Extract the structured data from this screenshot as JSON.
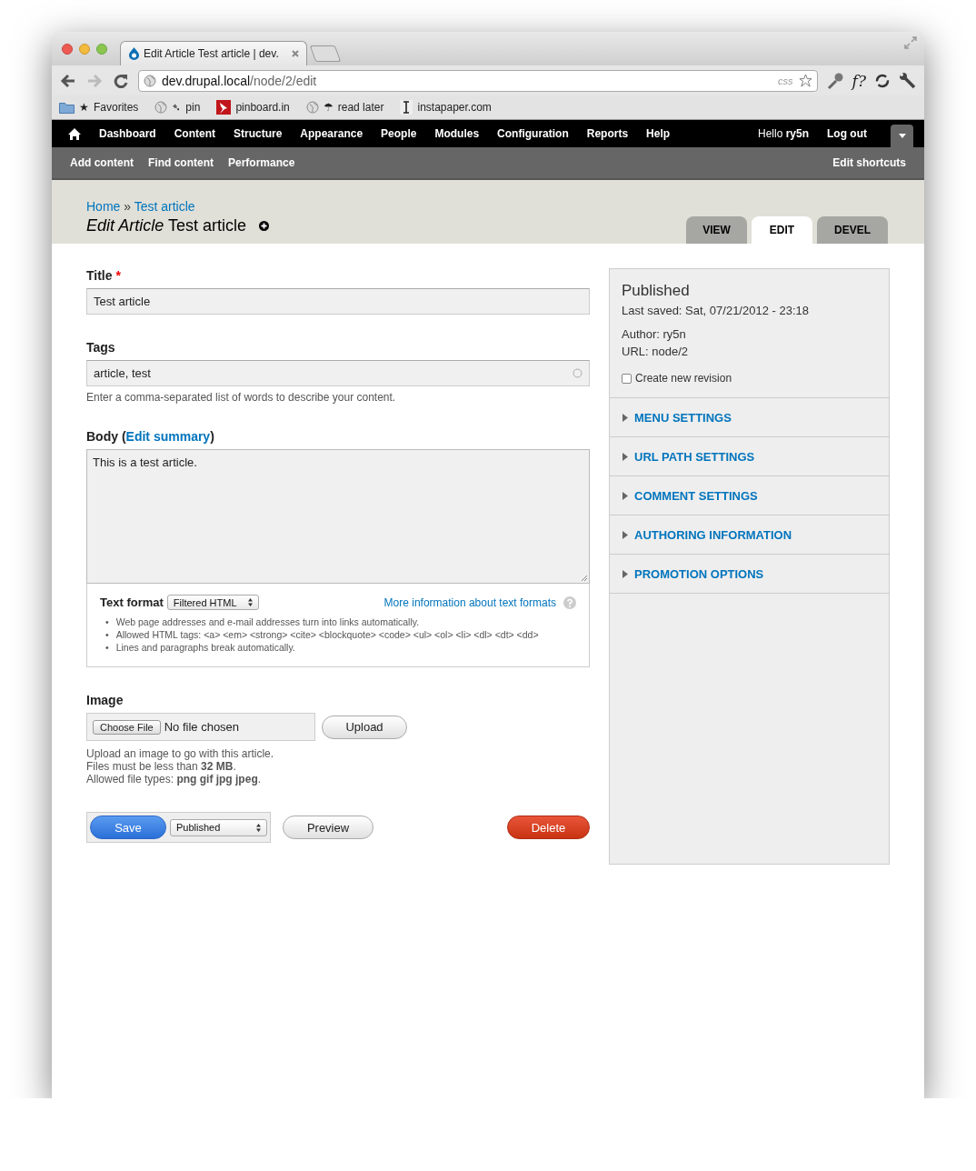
{
  "browser": {
    "tab_title": "Edit Article Test article | dev.",
    "url_host": "dev.drupal.local",
    "url_path": "/node/2/edit",
    "url_badge": "css",
    "extension_label": "f?",
    "bookmarks": [
      {
        "kind": "folder",
        "prefix": "★",
        "label": "Favorites"
      },
      {
        "kind": "globe",
        "prefix": "➴",
        "label": "pin"
      },
      {
        "kind": "pinboard",
        "label": "pinboard.in"
      },
      {
        "kind": "globe",
        "prefix": "☂",
        "label": "read later"
      },
      {
        "kind": "instapaper",
        "label": "instapaper.com"
      }
    ]
  },
  "toolbar": {
    "menu": [
      "Dashboard",
      "Content",
      "Structure",
      "Appearance",
      "People",
      "Modules",
      "Configuration",
      "Reports",
      "Help"
    ],
    "greeting": "Hello **ry5n**",
    "logout": "Log out",
    "shortcuts": [
      "Add content",
      "Find content",
      "Performance"
    ],
    "edit_shortcuts": "Edit shortcuts"
  },
  "header": {
    "breadcrumb": [
      "Home",
      "Test article"
    ],
    "separator": "»",
    "title": "*Edit Article* Test article",
    "tabs": [
      {
        "label": "VIEW",
        "selected": false
      },
      {
        "label": "EDIT",
        "selected": true
      },
      {
        "label": "DEVEL",
        "selected": false
      }
    ]
  },
  "form": {
    "title": {
      "label": "Title",
      "required_mark": "*",
      "value": "Test article"
    },
    "tags": {
      "label": "Tags",
      "value": "article, test",
      "description": "Enter a comma-separated list of words to describe your content."
    },
    "body": {
      "label_before": "Body (",
      "link": "Edit summary",
      "label_after": ")",
      "value": "This is a test article.",
      "text_format": {
        "label": "Text format",
        "selected": "Filtered HTML",
        "help_link": "More information about text formats",
        "bullet": "•",
        "tips": [
          "Web page addresses and e-mail addresses turn into links automatically.",
          "Allowed HTML tags: <a> <em> <strong> <cite> <blockquote> <code> <ul> <ol> <li> <dl> <dt> <dd>",
          "Lines and paragraphs break automatically."
        ]
      }
    },
    "image": {
      "label": "Image",
      "choose_button": "Choose File",
      "file_status": "No file chosen",
      "upload_button": "Upload",
      "description": [
        "Upload an image to go with this article.",
        "Files must be less than **32 MB**.",
        "Allowed file types: **png gif jpg jpeg**."
      ]
    },
    "actions": {
      "save": "Save",
      "status_select": "Published",
      "preview": "Preview",
      "delete": "Delete"
    }
  },
  "sidebar": {
    "status": "Published",
    "last_saved": "Last saved: Sat, 07/21/2012 - 23:18",
    "author": "Author: ry5n",
    "url": "URL: node/2",
    "revision": {
      "label": "Create new revision",
      "checked": false
    },
    "sections": [
      {
        "label": "MENU SETTINGS",
        "expanded": false
      },
      {
        "label": "URL PATH SETTINGS",
        "expanded": false
      },
      {
        "label": "COMMENT SETTINGS",
        "expanded": false
      },
      {
        "label": "AUTHORING INFORMATION",
        "expanded": false
      },
      {
        "label": "PROMOTION OPTIONS",
        "expanded": false
      }
    ]
  }
}
